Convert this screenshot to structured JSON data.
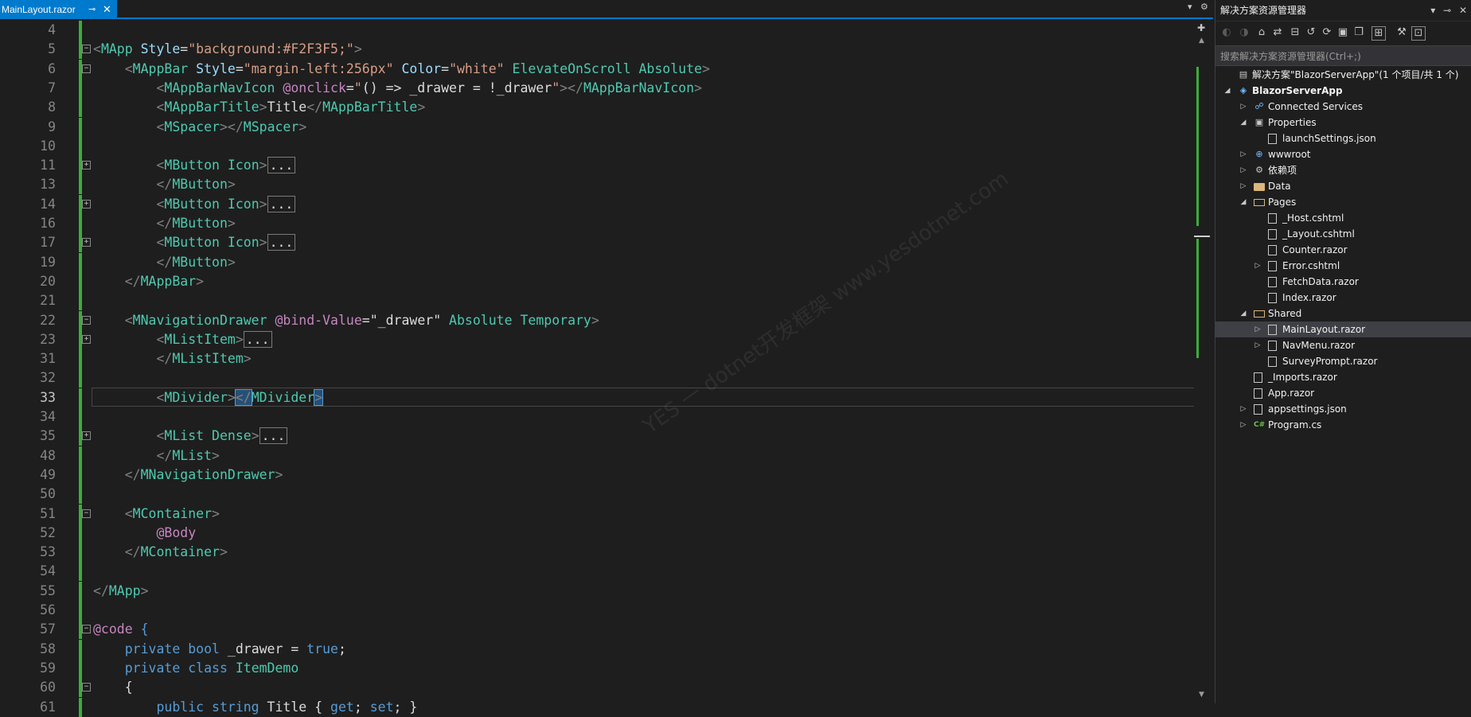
{
  "tab": {
    "title": "MainLayout.razor",
    "pin": "⊸",
    "close": "✕"
  },
  "tab_right": {
    "dropdown": "▾",
    "gear": "⚙"
  },
  "colors": {
    "tag": "#808080",
    "element": "#4ec9b0",
    "attr": "#9cdcfe",
    "string": "#d69d85",
    "keyword": "#569cd6",
    "razor": "#c586c0",
    "plain": "#dcdcdc",
    "linenum": "#858585",
    "change": "#3bad3b"
  },
  "code_lines": [
    {
      "n": "4",
      "tokens": []
    },
    {
      "n": "5",
      "fold": "−",
      "tokens": [
        [
          "<",
          "t"
        ],
        [
          "MApp",
          "e"
        ],
        [
          " Style",
          "a"
        ],
        [
          "=",
          "p"
        ],
        [
          "\"background:#F2F3F5;\"",
          "s"
        ],
        [
          ">",
          "t"
        ]
      ]
    },
    {
      "n": "6",
      "fold": "−",
      "tokens": [
        [
          "    <",
          "t"
        ],
        [
          "MAppBar",
          "e"
        ],
        [
          " Style",
          "a"
        ],
        [
          "=",
          "p"
        ],
        [
          "\"margin-left:256px\"",
          "s"
        ],
        [
          " Color",
          "a"
        ],
        [
          "=",
          "p"
        ],
        [
          "\"white\"",
          "s"
        ],
        [
          " ElevateOnScroll Absolute",
          "e"
        ],
        [
          ">",
          "t"
        ]
      ]
    },
    {
      "n": "7",
      "tokens": [
        [
          "        <",
          "t"
        ],
        [
          "MAppBarNavIcon",
          "e"
        ],
        [
          " @onclick",
          "r"
        ],
        [
          "=",
          "p"
        ],
        [
          "\"",
          "s"
        ],
        [
          "() => _drawer = !_drawer",
          "p"
        ],
        [
          "\"",
          "s"
        ],
        [
          "></",
          "t"
        ],
        [
          "MAppBarNavIcon",
          "e"
        ],
        [
          ">",
          "t"
        ]
      ]
    },
    {
      "n": "8",
      "tokens": [
        [
          "        <",
          "t"
        ],
        [
          "MAppBarTitle",
          "e"
        ],
        [
          ">",
          "t"
        ],
        [
          "Title",
          "p"
        ],
        [
          "</",
          "t"
        ],
        [
          "MAppBarTitle",
          "e"
        ],
        [
          ">",
          "t"
        ]
      ]
    },
    {
      "n": "9",
      "tokens": [
        [
          "        <",
          "t"
        ],
        [
          "MSpacer",
          "e"
        ],
        [
          "></",
          "t"
        ],
        [
          "MSpacer",
          "e"
        ],
        [
          ">",
          "t"
        ]
      ]
    },
    {
      "n": "10",
      "tokens": []
    },
    {
      "n": "11",
      "fold": "+",
      "tokens": [
        [
          "        <",
          "t"
        ],
        [
          "MButton",
          "e"
        ],
        [
          " Icon",
          "e"
        ],
        [
          ">",
          "t"
        ],
        [
          "...",
          "c"
        ]
      ]
    },
    {
      "n": "13",
      "tokens": [
        [
          "        </",
          "t"
        ],
        [
          "MButton",
          "e"
        ],
        [
          ">",
          "t"
        ]
      ]
    },
    {
      "n": "14",
      "fold": "+",
      "tokens": [
        [
          "        <",
          "t"
        ],
        [
          "MButton",
          "e"
        ],
        [
          " Icon",
          "e"
        ],
        [
          ">",
          "t"
        ],
        [
          "...",
          "c"
        ]
      ]
    },
    {
      "n": "16",
      "tokens": [
        [
          "        </",
          "t"
        ],
        [
          "MButton",
          "e"
        ],
        [
          ">",
          "t"
        ]
      ]
    },
    {
      "n": "17",
      "fold": "+",
      "tokens": [
        [
          "        <",
          "t"
        ],
        [
          "MButton",
          "e"
        ],
        [
          " Icon",
          "e"
        ],
        [
          ">",
          "t"
        ],
        [
          "...",
          "c"
        ]
      ]
    },
    {
      "n": "19",
      "tokens": [
        [
          "        </",
          "t"
        ],
        [
          "MButton",
          "e"
        ],
        [
          ">",
          "t"
        ]
      ]
    },
    {
      "n": "20",
      "tokens": [
        [
          "    </",
          "t"
        ],
        [
          "MAppBar",
          "e"
        ],
        [
          ">",
          "t"
        ]
      ]
    },
    {
      "n": "21",
      "tokens": []
    },
    {
      "n": "22",
      "fold": "−",
      "tokens": [
        [
          "    <",
          "t"
        ],
        [
          "MNavigationDrawer",
          "e"
        ],
        [
          " @bind-Value",
          "r"
        ],
        [
          "=",
          "p"
        ],
        [
          "\"_drawer\"",
          "p"
        ],
        [
          " Absolute Temporary",
          "e"
        ],
        [
          ">",
          "t"
        ]
      ]
    },
    {
      "n": "23",
      "fold": "+",
      "tokens": [
        [
          "        <",
          "t"
        ],
        [
          "MListItem",
          "e"
        ],
        [
          ">",
          "t"
        ],
        [
          "...",
          "c"
        ]
      ]
    },
    {
      "n": "31",
      "tokens": [
        [
          "        </",
          "t"
        ],
        [
          "MListItem",
          "e"
        ],
        [
          ">",
          "t"
        ]
      ]
    },
    {
      "n": "32",
      "tokens": []
    },
    {
      "n": "33",
      "tokens": [
        [
          "        <",
          "t"
        ],
        [
          "MDivider",
          "e"
        ],
        [
          ">",
          "t"
        ],
        [
          "</",
          "h"
        ],
        [
          "MDivider",
          "e"
        ],
        [
          ">",
          "h"
        ]
      ]
    },
    {
      "n": "34",
      "tokens": []
    },
    {
      "n": "35",
      "fold": "+",
      "tokens": [
        [
          "        <",
          "t"
        ],
        [
          "MList",
          "e"
        ],
        [
          " Dense",
          "e"
        ],
        [
          ">",
          "t"
        ],
        [
          "...",
          "c"
        ]
      ]
    },
    {
      "n": "48",
      "tokens": [
        [
          "        </",
          "t"
        ],
        [
          "MList",
          "e"
        ],
        [
          ">",
          "t"
        ]
      ]
    },
    {
      "n": "49",
      "tokens": [
        [
          "    </",
          "t"
        ],
        [
          "MNavigationDrawer",
          "e"
        ],
        [
          ">",
          "t"
        ]
      ]
    },
    {
      "n": "50",
      "tokens": []
    },
    {
      "n": "51",
      "fold": "−",
      "tokens": [
        [
          "    <",
          "t"
        ],
        [
          "MContainer",
          "e"
        ],
        [
          ">",
          "t"
        ]
      ]
    },
    {
      "n": "52",
      "tokens": [
        [
          "        @Body",
          "r"
        ]
      ]
    },
    {
      "n": "53",
      "tokens": [
        [
          "    </",
          "t"
        ],
        [
          "MContainer",
          "e"
        ],
        [
          ">",
          "t"
        ]
      ]
    },
    {
      "n": "54",
      "tokens": []
    },
    {
      "n": "55",
      "tokens": [
        [
          "</",
          "t"
        ],
        [
          "MApp",
          "e"
        ],
        [
          ">",
          "t"
        ]
      ]
    },
    {
      "n": "56",
      "tokens": []
    },
    {
      "n": "57",
      "fold": "−",
      "tokens": [
        [
          "@code",
          "r"
        ],
        [
          " {",
          "k"
        ]
      ]
    },
    {
      "n": "58",
      "tokens": [
        [
          "    private bool",
          "k"
        ],
        [
          " _drawer = ",
          "p"
        ],
        [
          "true",
          "k"
        ],
        [
          ";",
          "p"
        ]
      ]
    },
    {
      "n": "59",
      "tokens": [
        [
          "    private class",
          "k"
        ],
        [
          " ItemDemo",
          "e"
        ]
      ]
    },
    {
      "n": "60",
      "fold": "−",
      "tokens": [
        [
          "    {",
          "p"
        ]
      ]
    },
    {
      "n": "61",
      "tokens": [
        [
          "        public string",
          "k"
        ],
        [
          " Title { ",
          "p"
        ],
        [
          "get",
          "k"
        ],
        [
          "; ",
          "p"
        ],
        [
          "set",
          "k"
        ],
        [
          "; }",
          "p"
        ]
      ]
    }
  ],
  "solution_explorer": {
    "title": "解决方案资源管理器",
    "search_placeholder": "搜索解决方案资源管理器(Ctrl+;)",
    "items": [
      {
        "label": "解决方案\"BlazorServerApp\"(1 个项目/共 1 个)",
        "depth": 0,
        "icon": "solution-icon",
        "arrow": ""
      },
      {
        "label": "BlazorServerApp",
        "depth": 0,
        "icon": "project-icon",
        "arrow": "◢",
        "bold": true
      },
      {
        "label": "Connected Services",
        "depth": 1,
        "icon": "connected-services-icon",
        "arrow": "▷"
      },
      {
        "label": "Properties",
        "depth": 1,
        "icon": "properties-icon",
        "arrow": "◢"
      },
      {
        "label": "launchSettings.json",
        "depth": 2,
        "icon": "json-file-icon",
        "arrow": ""
      },
      {
        "label": "wwwroot",
        "depth": 1,
        "icon": "globe-icon",
        "arrow": "▷"
      },
      {
        "label": "依赖项",
        "depth": 1,
        "icon": "dependencies-icon",
        "arrow": "▷"
      },
      {
        "label": "Data",
        "depth": 1,
        "icon": "folder-icon",
        "arrow": "▷"
      },
      {
        "label": "Pages",
        "depth": 1,
        "icon": "folder-open-icon",
        "arrow": "◢"
      },
      {
        "label": "_Host.cshtml",
        "depth": 2,
        "icon": "file-icon",
        "arrow": ""
      },
      {
        "label": "_Layout.cshtml",
        "depth": 2,
        "icon": "file-icon",
        "arrow": ""
      },
      {
        "label": "Counter.razor",
        "depth": 2,
        "icon": "razor-file-icon",
        "arrow": ""
      },
      {
        "label": "Error.cshtml",
        "depth": 2,
        "icon": "file-icon",
        "arrow": "▷"
      },
      {
        "label": "FetchData.razor",
        "depth": 2,
        "icon": "razor-file-icon",
        "arrow": ""
      },
      {
        "label": "Index.razor",
        "depth": 2,
        "icon": "razor-file-icon",
        "arrow": ""
      },
      {
        "label": "Shared",
        "depth": 1,
        "icon": "folder-open-icon",
        "arrow": "◢"
      },
      {
        "label": "MainLayout.razor",
        "depth": 2,
        "icon": "razor-file-icon",
        "arrow": "▷",
        "selected": true
      },
      {
        "label": "NavMenu.razor",
        "depth": 2,
        "icon": "razor-file-icon",
        "arrow": "▷"
      },
      {
        "label": "SurveyPrompt.razor",
        "depth": 2,
        "icon": "razor-file-icon",
        "arrow": ""
      },
      {
        "label": "_Imports.razor",
        "depth": 1,
        "icon": "razor-file-icon",
        "arrow": ""
      },
      {
        "label": "App.razor",
        "depth": 1,
        "icon": "razor-file-icon",
        "arrow": ""
      },
      {
        "label": "appsettings.json",
        "depth": 1,
        "icon": "json-file-icon",
        "arrow": "▷"
      },
      {
        "label": "Program.cs",
        "depth": 1,
        "icon": "csharp-file-icon",
        "arrow": "▷",
        "badge": "C#"
      }
    ]
  },
  "watermark": "YES 一 dotnet开发框架 www.yesdotnet.com"
}
